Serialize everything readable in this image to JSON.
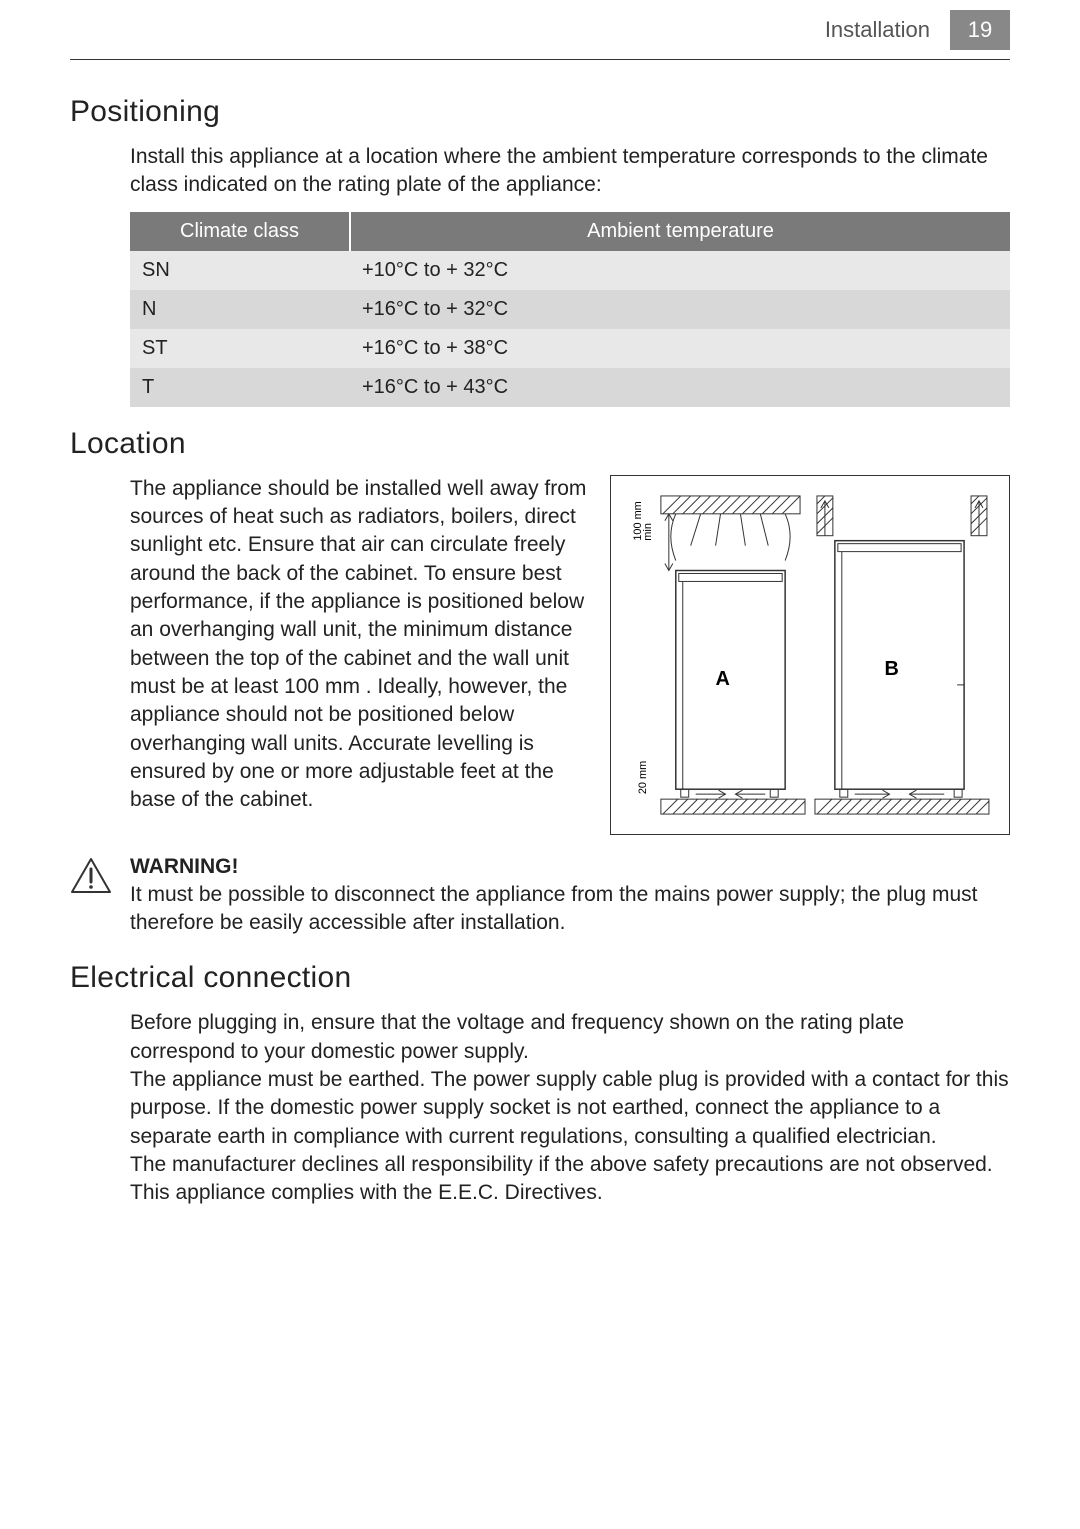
{
  "header": {
    "section": "Installation",
    "pageNumber": "19"
  },
  "positioning": {
    "heading": "Positioning",
    "intro": "Install this appliance at a location where the ambient temperature corresponds to the climate class indicated on the rating plate of the appliance:",
    "table": {
      "headers": [
        "Climate class",
        "Ambient temperature"
      ],
      "rows": [
        {
          "class": "SN",
          "temp": "+10°C to + 32°C"
        },
        {
          "class": "N",
          "temp": "+16°C to + 32°C"
        },
        {
          "class": "ST",
          "temp": "+16°C to + 38°C"
        },
        {
          "class": "T",
          "temp": "+16°C to + 43°C"
        }
      ]
    }
  },
  "location": {
    "heading": "Location",
    "text": "The appliance should be installed well away from sources of heat such as radiators, boilers, direct sunlight etc. Ensure that air can circulate freely around the back of the cabinet. To ensure best performance, if the appliance is positioned below an overhanging wall unit, the minimum distance between the top of the cabinet and the wall unit must be at least 100 mm . Ideally, however, the appliance should not be positioned below overhanging wall units. Accurate levelling is ensured by one or more adjustable feet at the base of the cabinet.",
    "diagram": {
      "labelA": "A",
      "labelB": "B",
      "topClearance": "100 mm min",
      "bottomClearance": "20 mm"
    }
  },
  "warning": {
    "label": "WARNING!",
    "text": "It must be possible to disconnect the appliance from the mains power supply; the plug must therefore be easily accessible after installation."
  },
  "electrical": {
    "heading": "Electrical connection",
    "para1": "Before plugging in, ensure that the voltage and frequency shown on the rating plate correspond to your domestic power supply.",
    "para2": "The appliance must be earthed. The power supply cable plug is provided with a contact for this purpose. If the domestic power supply socket is not earthed, connect the appliance to a separate earth in compliance with current regulations, consulting a qualified electrician.",
    "para3": "The manufacturer declines all responsibility if the above safety precautions are not observed.",
    "para4": "This appliance complies with the E.E.C. Directives."
  }
}
